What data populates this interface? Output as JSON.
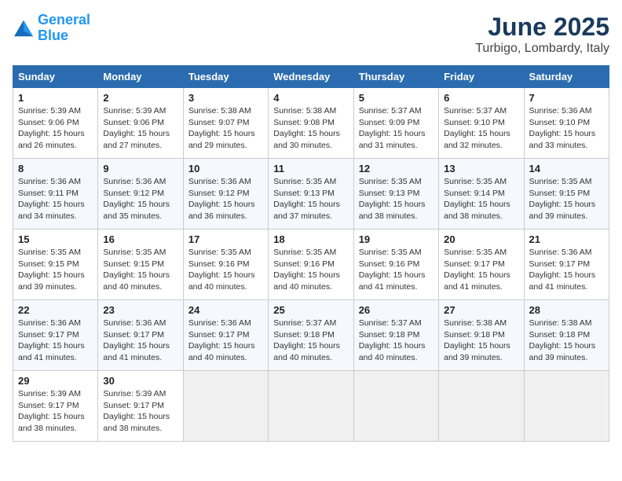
{
  "logo": {
    "line1": "General",
    "line2": "Blue"
  },
  "title": "June 2025",
  "subtitle": "Turbigo, Lombardy, Italy",
  "weekdays": [
    "Sunday",
    "Monday",
    "Tuesday",
    "Wednesday",
    "Thursday",
    "Friday",
    "Saturday"
  ],
  "weeks": [
    [
      {
        "day": "1",
        "info": "Sunrise: 5:39 AM\nSunset: 9:06 PM\nDaylight: 15 hours\nand 26 minutes."
      },
      {
        "day": "2",
        "info": "Sunrise: 5:39 AM\nSunset: 9:06 PM\nDaylight: 15 hours\nand 27 minutes."
      },
      {
        "day": "3",
        "info": "Sunrise: 5:38 AM\nSunset: 9:07 PM\nDaylight: 15 hours\nand 29 minutes."
      },
      {
        "day": "4",
        "info": "Sunrise: 5:38 AM\nSunset: 9:08 PM\nDaylight: 15 hours\nand 30 minutes."
      },
      {
        "day": "5",
        "info": "Sunrise: 5:37 AM\nSunset: 9:09 PM\nDaylight: 15 hours\nand 31 minutes."
      },
      {
        "day": "6",
        "info": "Sunrise: 5:37 AM\nSunset: 9:10 PM\nDaylight: 15 hours\nand 32 minutes."
      },
      {
        "day": "7",
        "info": "Sunrise: 5:36 AM\nSunset: 9:10 PM\nDaylight: 15 hours\nand 33 minutes."
      }
    ],
    [
      {
        "day": "8",
        "info": "Sunrise: 5:36 AM\nSunset: 9:11 PM\nDaylight: 15 hours\nand 34 minutes."
      },
      {
        "day": "9",
        "info": "Sunrise: 5:36 AM\nSunset: 9:12 PM\nDaylight: 15 hours\nand 35 minutes."
      },
      {
        "day": "10",
        "info": "Sunrise: 5:36 AM\nSunset: 9:12 PM\nDaylight: 15 hours\nand 36 minutes."
      },
      {
        "day": "11",
        "info": "Sunrise: 5:35 AM\nSunset: 9:13 PM\nDaylight: 15 hours\nand 37 minutes."
      },
      {
        "day": "12",
        "info": "Sunrise: 5:35 AM\nSunset: 9:13 PM\nDaylight: 15 hours\nand 38 minutes."
      },
      {
        "day": "13",
        "info": "Sunrise: 5:35 AM\nSunset: 9:14 PM\nDaylight: 15 hours\nand 38 minutes."
      },
      {
        "day": "14",
        "info": "Sunrise: 5:35 AM\nSunset: 9:15 PM\nDaylight: 15 hours\nand 39 minutes."
      }
    ],
    [
      {
        "day": "15",
        "info": "Sunrise: 5:35 AM\nSunset: 9:15 PM\nDaylight: 15 hours\nand 39 minutes."
      },
      {
        "day": "16",
        "info": "Sunrise: 5:35 AM\nSunset: 9:15 PM\nDaylight: 15 hours\nand 40 minutes."
      },
      {
        "day": "17",
        "info": "Sunrise: 5:35 AM\nSunset: 9:16 PM\nDaylight: 15 hours\nand 40 minutes."
      },
      {
        "day": "18",
        "info": "Sunrise: 5:35 AM\nSunset: 9:16 PM\nDaylight: 15 hours\nand 40 minutes."
      },
      {
        "day": "19",
        "info": "Sunrise: 5:35 AM\nSunset: 9:16 PM\nDaylight: 15 hours\nand 41 minutes."
      },
      {
        "day": "20",
        "info": "Sunrise: 5:35 AM\nSunset: 9:17 PM\nDaylight: 15 hours\nand 41 minutes."
      },
      {
        "day": "21",
        "info": "Sunrise: 5:36 AM\nSunset: 9:17 PM\nDaylight: 15 hours\nand 41 minutes."
      }
    ],
    [
      {
        "day": "22",
        "info": "Sunrise: 5:36 AM\nSunset: 9:17 PM\nDaylight: 15 hours\nand 41 minutes."
      },
      {
        "day": "23",
        "info": "Sunrise: 5:36 AM\nSunset: 9:17 PM\nDaylight: 15 hours\nand 41 minutes."
      },
      {
        "day": "24",
        "info": "Sunrise: 5:36 AM\nSunset: 9:17 PM\nDaylight: 15 hours\nand 40 minutes."
      },
      {
        "day": "25",
        "info": "Sunrise: 5:37 AM\nSunset: 9:18 PM\nDaylight: 15 hours\nand 40 minutes."
      },
      {
        "day": "26",
        "info": "Sunrise: 5:37 AM\nSunset: 9:18 PM\nDaylight: 15 hours\nand 40 minutes."
      },
      {
        "day": "27",
        "info": "Sunrise: 5:38 AM\nSunset: 9:18 PM\nDaylight: 15 hours\nand 39 minutes."
      },
      {
        "day": "28",
        "info": "Sunrise: 5:38 AM\nSunset: 9:18 PM\nDaylight: 15 hours\nand 39 minutes."
      }
    ],
    [
      {
        "day": "29",
        "info": "Sunrise: 5:39 AM\nSunset: 9:17 PM\nDaylight: 15 hours\nand 38 minutes."
      },
      {
        "day": "30",
        "info": "Sunrise: 5:39 AM\nSunset: 9:17 PM\nDaylight: 15 hours\nand 38 minutes."
      },
      {
        "day": "",
        "info": ""
      },
      {
        "day": "",
        "info": ""
      },
      {
        "day": "",
        "info": ""
      },
      {
        "day": "",
        "info": ""
      },
      {
        "day": "",
        "info": ""
      }
    ]
  ]
}
